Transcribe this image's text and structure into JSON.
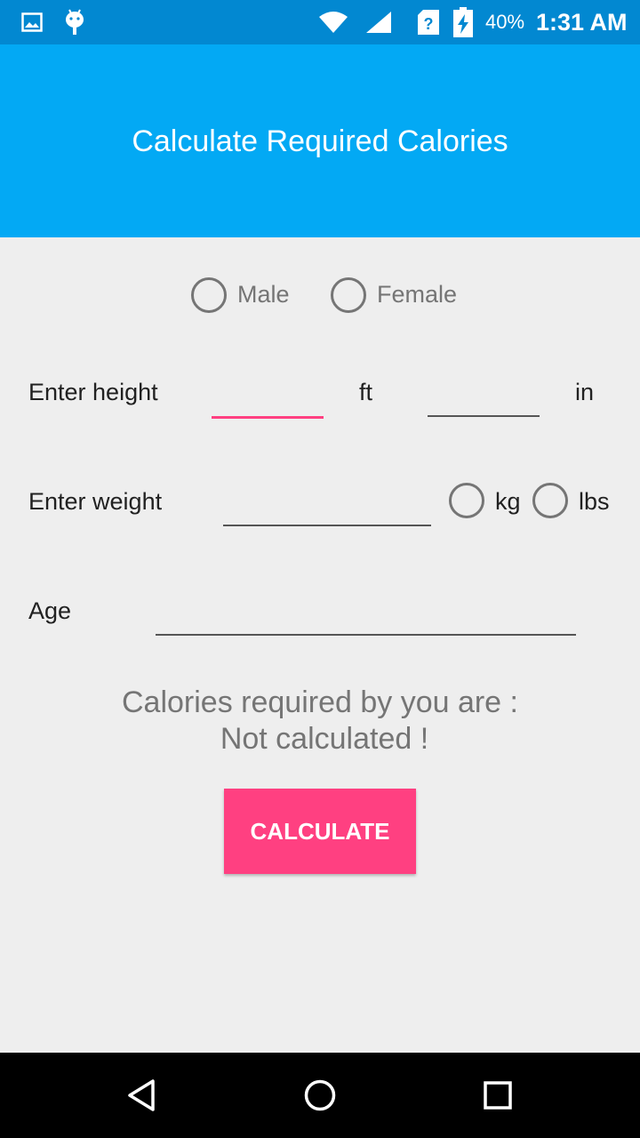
{
  "status_bar": {
    "battery_percent": "40%",
    "time": "1:31 AM",
    "icons": [
      "gallery-icon",
      "android-icon",
      "wifi-icon",
      "signal-icon",
      "sim-unknown-icon",
      "battery-charging-icon"
    ]
  },
  "app_bar": {
    "title": "Calculate Required Calories",
    "color": "#03a9f4"
  },
  "gender": {
    "options": [
      "Male",
      "Female"
    ],
    "selected": null
  },
  "height": {
    "label": "Enter height",
    "feet_value": "",
    "feet_unit": "ft",
    "inches_value": "",
    "inches_unit": "in"
  },
  "weight": {
    "label": "Enter weight",
    "value": "",
    "units": [
      "kg",
      "lbs"
    ],
    "selected_unit": null
  },
  "age": {
    "label": "Age",
    "value": ""
  },
  "result": {
    "line1": "Calories required by you are :",
    "line2": "Not calculated !"
  },
  "calculate_button": {
    "label": "CALCULATE",
    "color": "#ff4081"
  },
  "nav_bar": {
    "buttons": [
      "back-icon",
      "home-icon",
      "recents-icon"
    ]
  }
}
